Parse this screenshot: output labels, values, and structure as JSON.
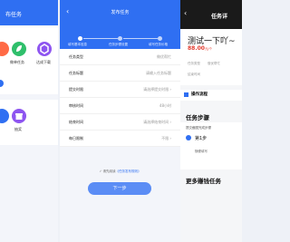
{
  "panel1": {
    "title": "布任务",
    "apps": [
      {
        "label": "",
        "icon": "task-icon",
        "color": "#ff6a45"
      },
      {
        "label": "做单任务",
        "icon": "leaf-icon",
        "color": "#2fbf6b"
      },
      {
        "label": "达成下载",
        "icon": "hexagon-icon",
        "color": "#8e55f0"
      }
    ],
    "more_label": "抽奖"
  },
  "panel2": {
    "title": "发布任务",
    "steps": [
      "填写基本信息",
      "任务步骤设置",
      "填写任务价格"
    ],
    "rows": [
      {
        "key": "任务类型",
        "value": "做优帮忙"
      },
      {
        "key": "任务标题",
        "value": "请输入任务标题"
      },
      {
        "key": "提交时限",
        "value": "请选择提交时限 ›"
      },
      {
        "key": "审核时间",
        "value": "48小时"
      },
      {
        "key": "结束时间",
        "value": "请选择结束时间 ›"
      },
      {
        "key": "每日限制",
        "value": "不限 ›"
      }
    ],
    "agree_prefix": "请先阅读",
    "agree_link": "《任务发布规则》",
    "next_label": "下一步"
  },
  "panel3": {
    "title": "任务详",
    "task_title": "测试一下吖~",
    "price": "88.00",
    "price_unit": "元/个",
    "mini_labels": [
      "任务类型",
      "做优帮忙",
      "结束时间"
    ],
    "flow_label": "操作流程",
    "steps_heading": "任务步骤",
    "steps_sub": "提交截图完成步骤",
    "step1": "第1步",
    "step1_desc": "随便填写",
    "more_heading": "更多赚钱任务"
  },
  "colors": {
    "brand": "#2f6ff2",
    "price": "#e23b2e"
  }
}
